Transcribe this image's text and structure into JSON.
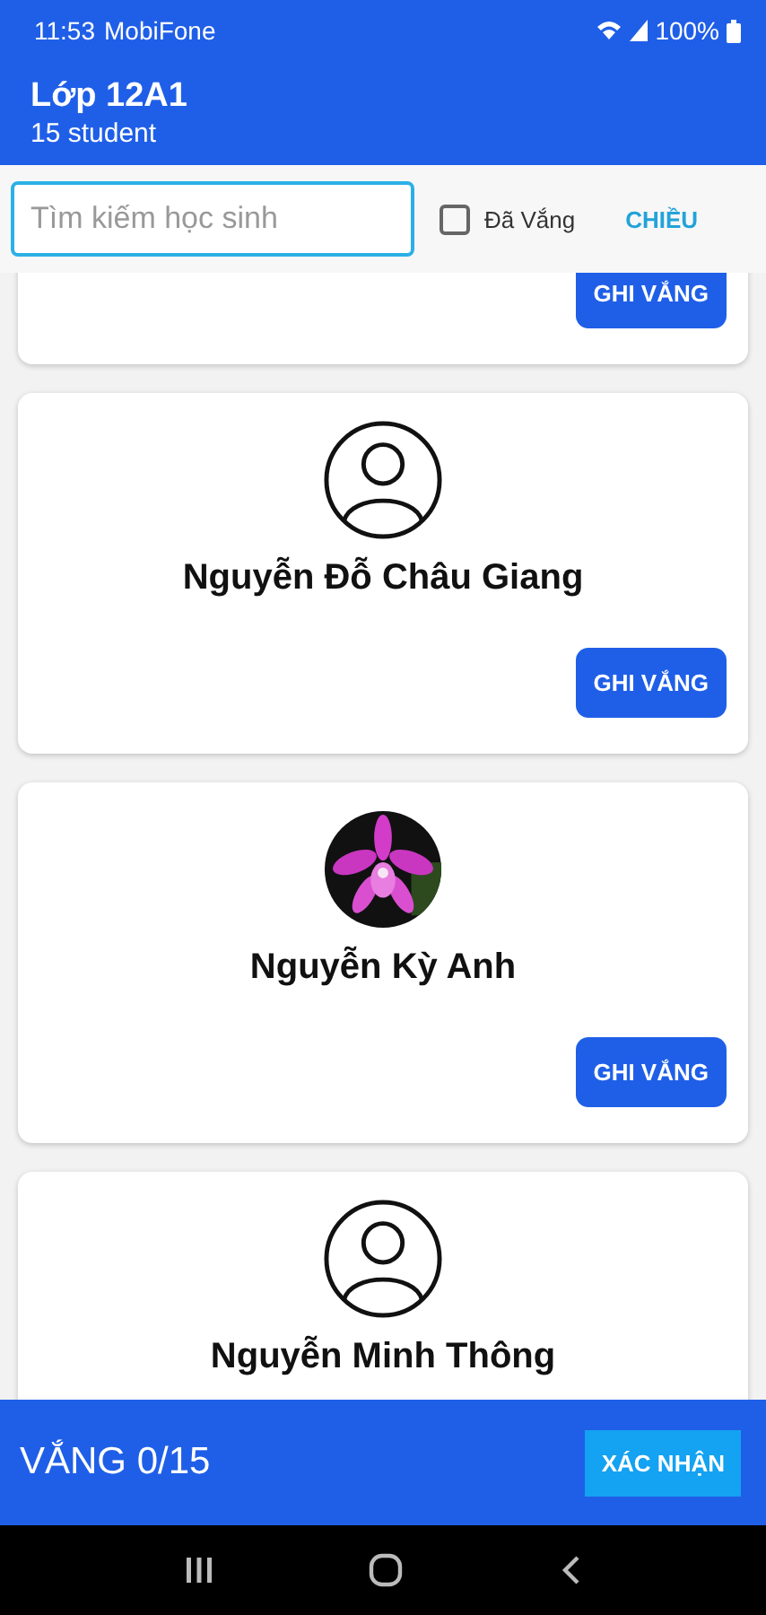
{
  "status_bar": {
    "time": "11:53",
    "carrier": "MobiFone",
    "battery": "100%"
  },
  "header": {
    "title": "Lớp 12A1",
    "subtitle": "15 student"
  },
  "filter": {
    "search": {
      "placeholder": "Tìm kiếm học sinh"
    },
    "absent_only": {
      "label": "Đã Vắng",
      "checked": false
    },
    "sort_button": "CHIỀU"
  },
  "students": [
    {
      "kind": "cut",
      "button": "GHI VẮNG"
    },
    {
      "kind": "placeholder",
      "name": "Nguyễn Đỗ Châu Giang",
      "button": "GHI VẮNG"
    },
    {
      "name": "Nguyễn Kỳ Anh",
      "button": "GHI VẮNG"
    },
    {
      "kind": "placeholder",
      "name": "Nguyễn Minh Thông"
    }
  ],
  "bottom_bar": {
    "count": "VẮNG 0/15",
    "confirm_button": "XÁC NHẬN"
  }
}
